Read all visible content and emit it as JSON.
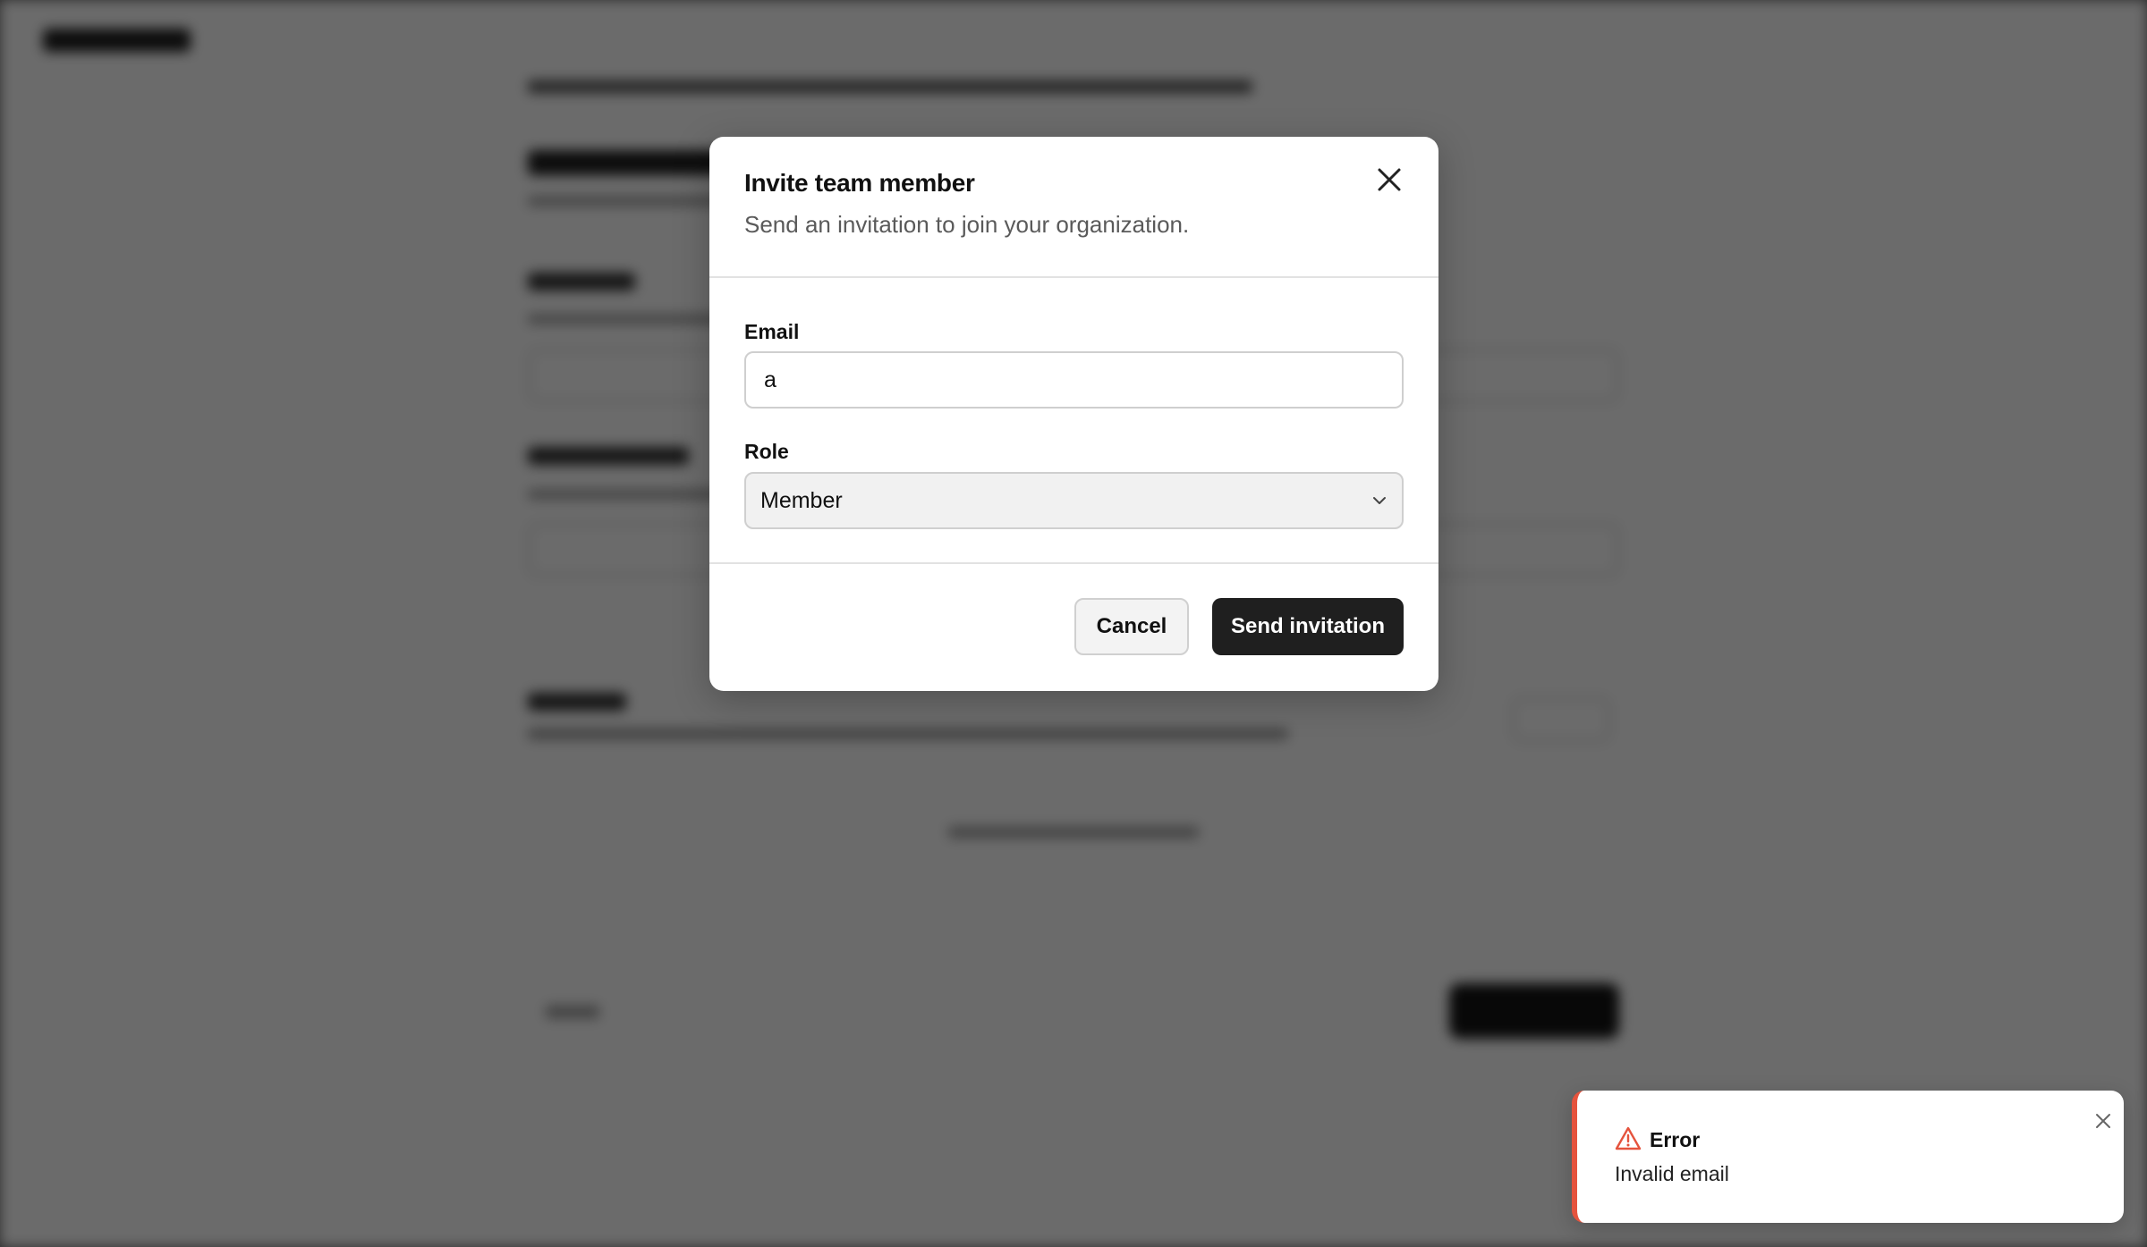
{
  "modal": {
    "title": "Invite team member",
    "description": "Send an invitation to join your organization.",
    "close_icon": "close-icon",
    "email": {
      "label": "Email",
      "value": "a"
    },
    "role": {
      "label": "Role",
      "selected": "Member",
      "icon": "chevron-down-icon"
    },
    "cancel_label": "Cancel",
    "send_label": "Send invitation"
  },
  "toast": {
    "icon": "warning-triangle-icon",
    "title": "Error",
    "message": "Invalid email",
    "accent_color": "#e5533d",
    "close_icon": "close-icon"
  },
  "colors": {
    "overlay": "#6a6a6a",
    "primary_button": "#1f1f1f",
    "error": "#e5533d"
  }
}
